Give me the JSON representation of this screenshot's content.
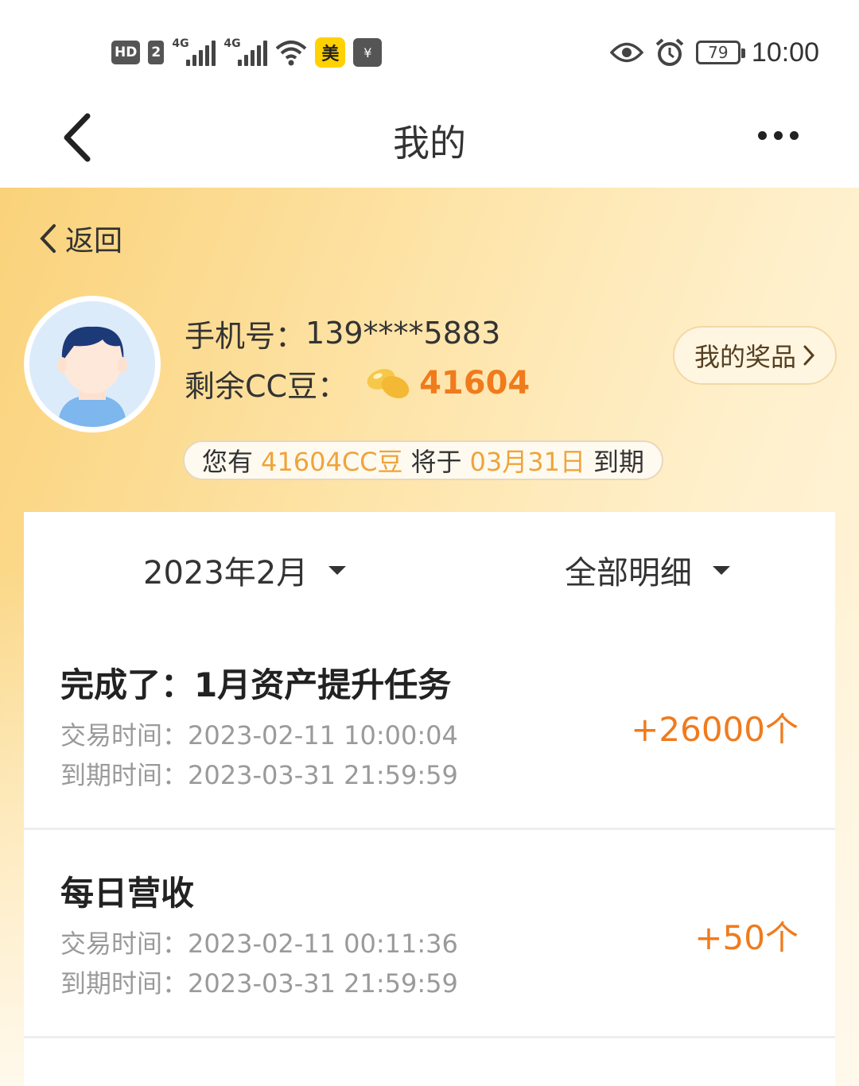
{
  "status_bar": {
    "hd": "HD",
    "sim": "2",
    "signal1_tag": "4G",
    "signal2_tag": "4G",
    "meituan": "美",
    "wallet": "¥",
    "battery": "79",
    "time": "10:00"
  },
  "header": {
    "title": "我的"
  },
  "nav": {
    "return_label": "返回"
  },
  "profile": {
    "phone_label": "手机号：",
    "phone_value": "139****5883",
    "beans_label": "剩余CC豆：",
    "beans_value": "41604",
    "prizes_button": "我的奖品"
  },
  "expiry_notice": {
    "prefix": "您有",
    "amount": "41604CC豆",
    "middle": "将于",
    "date": "03月31日",
    "suffix": "到期"
  },
  "filters": {
    "month": "2023年2月",
    "type": "全部明细"
  },
  "transactions": [
    {
      "title": "完成了：1月资产提升任务",
      "trade_time": "交易时间：2023-02-11 10:00:04",
      "expire_time": "到期时间：2023-03-31 21:59:59",
      "amount": "+26000个"
    },
    {
      "title": "每日营收",
      "trade_time": "交易时间：2023-02-11 00:11:36",
      "expire_time": "到期时间：2023-03-31 21:59:59",
      "amount": "+50个"
    }
  ],
  "colors": {
    "accent_orange": "#f07b1d",
    "highlight_gold": "#efa43a",
    "banner_gold": "#fad27a"
  }
}
